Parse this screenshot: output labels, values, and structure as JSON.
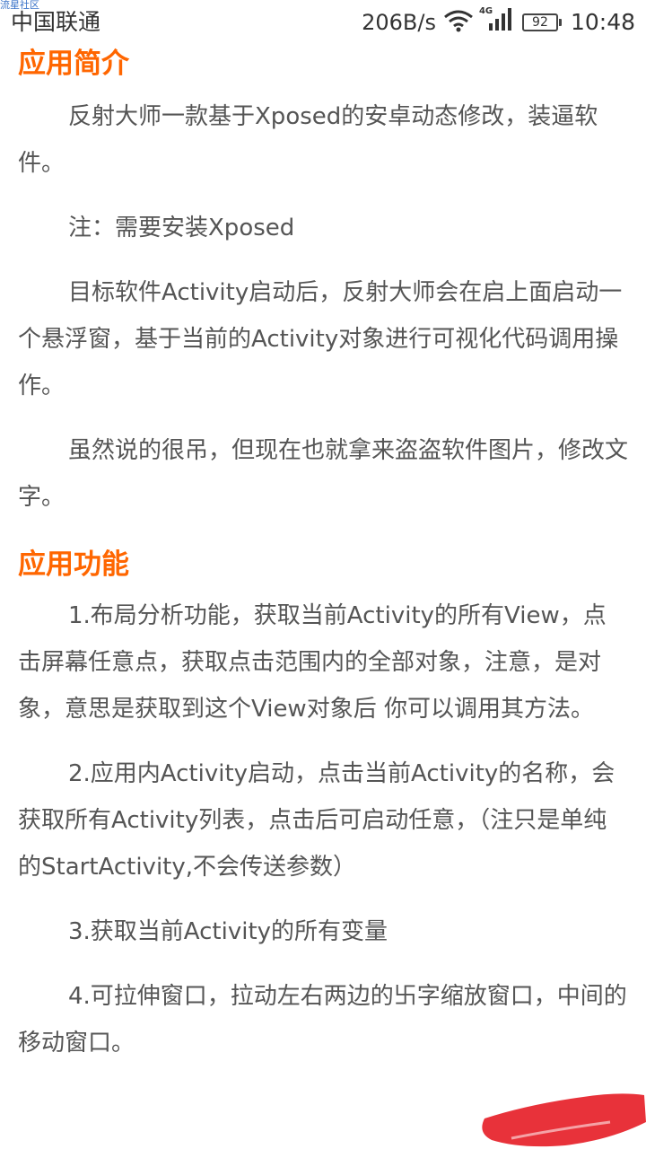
{
  "status_bar": {
    "watermark": "流星社区",
    "carrier": "中国联通",
    "net_speed": "206B/s",
    "net_type": "4G",
    "battery": "92",
    "time": "10:48"
  },
  "icons": {
    "wifi": "wifi-icon",
    "signal": "cell-signal-icon",
    "battery": "battery-icon"
  },
  "colors": {
    "heading": "#ff6600",
    "body_text": "#555555",
    "swipe_mark": "#e8323a"
  },
  "article": {
    "section1": {
      "title": "应用简介",
      "paragraphs": [
        "反射大师一款基于Xposed的安卓动态修改，装逼软件。",
        "注：需要安装Xposed",
        "目标软件Activity启动后，反射大师会在启上面启动一个悬浮窗，基于当前的Activity对象进行可视化代码调用操作。",
        "虽然说的很吊，但现在也就拿来盗盗软件图片，修改文字。"
      ]
    },
    "section2": {
      "title": "应用功能",
      "paragraphs": [
        "1.布局分析功能，获取当前Activity的所有View，点击屏幕任意点，获取点击范围内的全部对象，注意，是对象，意思是获取到这个View对象后 你可以调用其方法。",
        "2.应用内Activity启动，点击当前Activity的名称，会获取所有Activity列表，点击后可启动任意，（注只是单纯的StartActivity,不会传送参数）",
        "3.获取当前Activity的所有变量",
        "4.可拉伸窗口，拉动左右两边的卐字缩放窗口，中间的移动窗口。"
      ]
    }
  }
}
